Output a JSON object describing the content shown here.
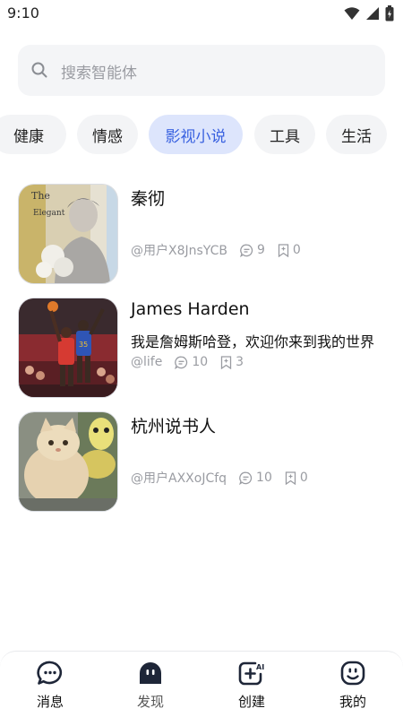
{
  "status_bar": {
    "time": "9:10"
  },
  "search": {
    "placeholder": "搜索智能体"
  },
  "tabs": [
    {
      "label": "健康",
      "active": false
    },
    {
      "label": "情感",
      "active": false
    },
    {
      "label": "影视小说",
      "active": true
    },
    {
      "label": "工具",
      "active": false
    },
    {
      "label": "生活",
      "active": false
    }
  ],
  "items": [
    {
      "title": "秦彻",
      "description": "",
      "author": "@用户X8JnsYCB",
      "comments": "9",
      "saves": "0",
      "thumb": "book-cover-portrait"
    },
    {
      "title": "James Harden",
      "description": "我是詹姆斯哈登，欢迎你来到我的世界",
      "author": "@life",
      "comments": "10",
      "saves": "3",
      "thumb": "basketball-photo"
    },
    {
      "title": "杭州说书人",
      "description": "",
      "author": "@用户AXXoJCfq",
      "comments": "10",
      "saves": "0",
      "thumb": "cat-photo"
    }
  ],
  "bottom_nav": [
    {
      "label": "消息",
      "icon": "message-icon",
      "active": false
    },
    {
      "label": "发现",
      "icon": "discover-icon",
      "active": true
    },
    {
      "label": "创建",
      "icon": "create-ai-icon",
      "active": false
    },
    {
      "label": "我的",
      "icon": "profile-icon",
      "active": false
    }
  ],
  "colors": {
    "accent": "#3a62e0",
    "accent_bg": "#dde5fc",
    "muted_text": "#9a9ca2",
    "chip_bg": "#f3f4f6"
  }
}
